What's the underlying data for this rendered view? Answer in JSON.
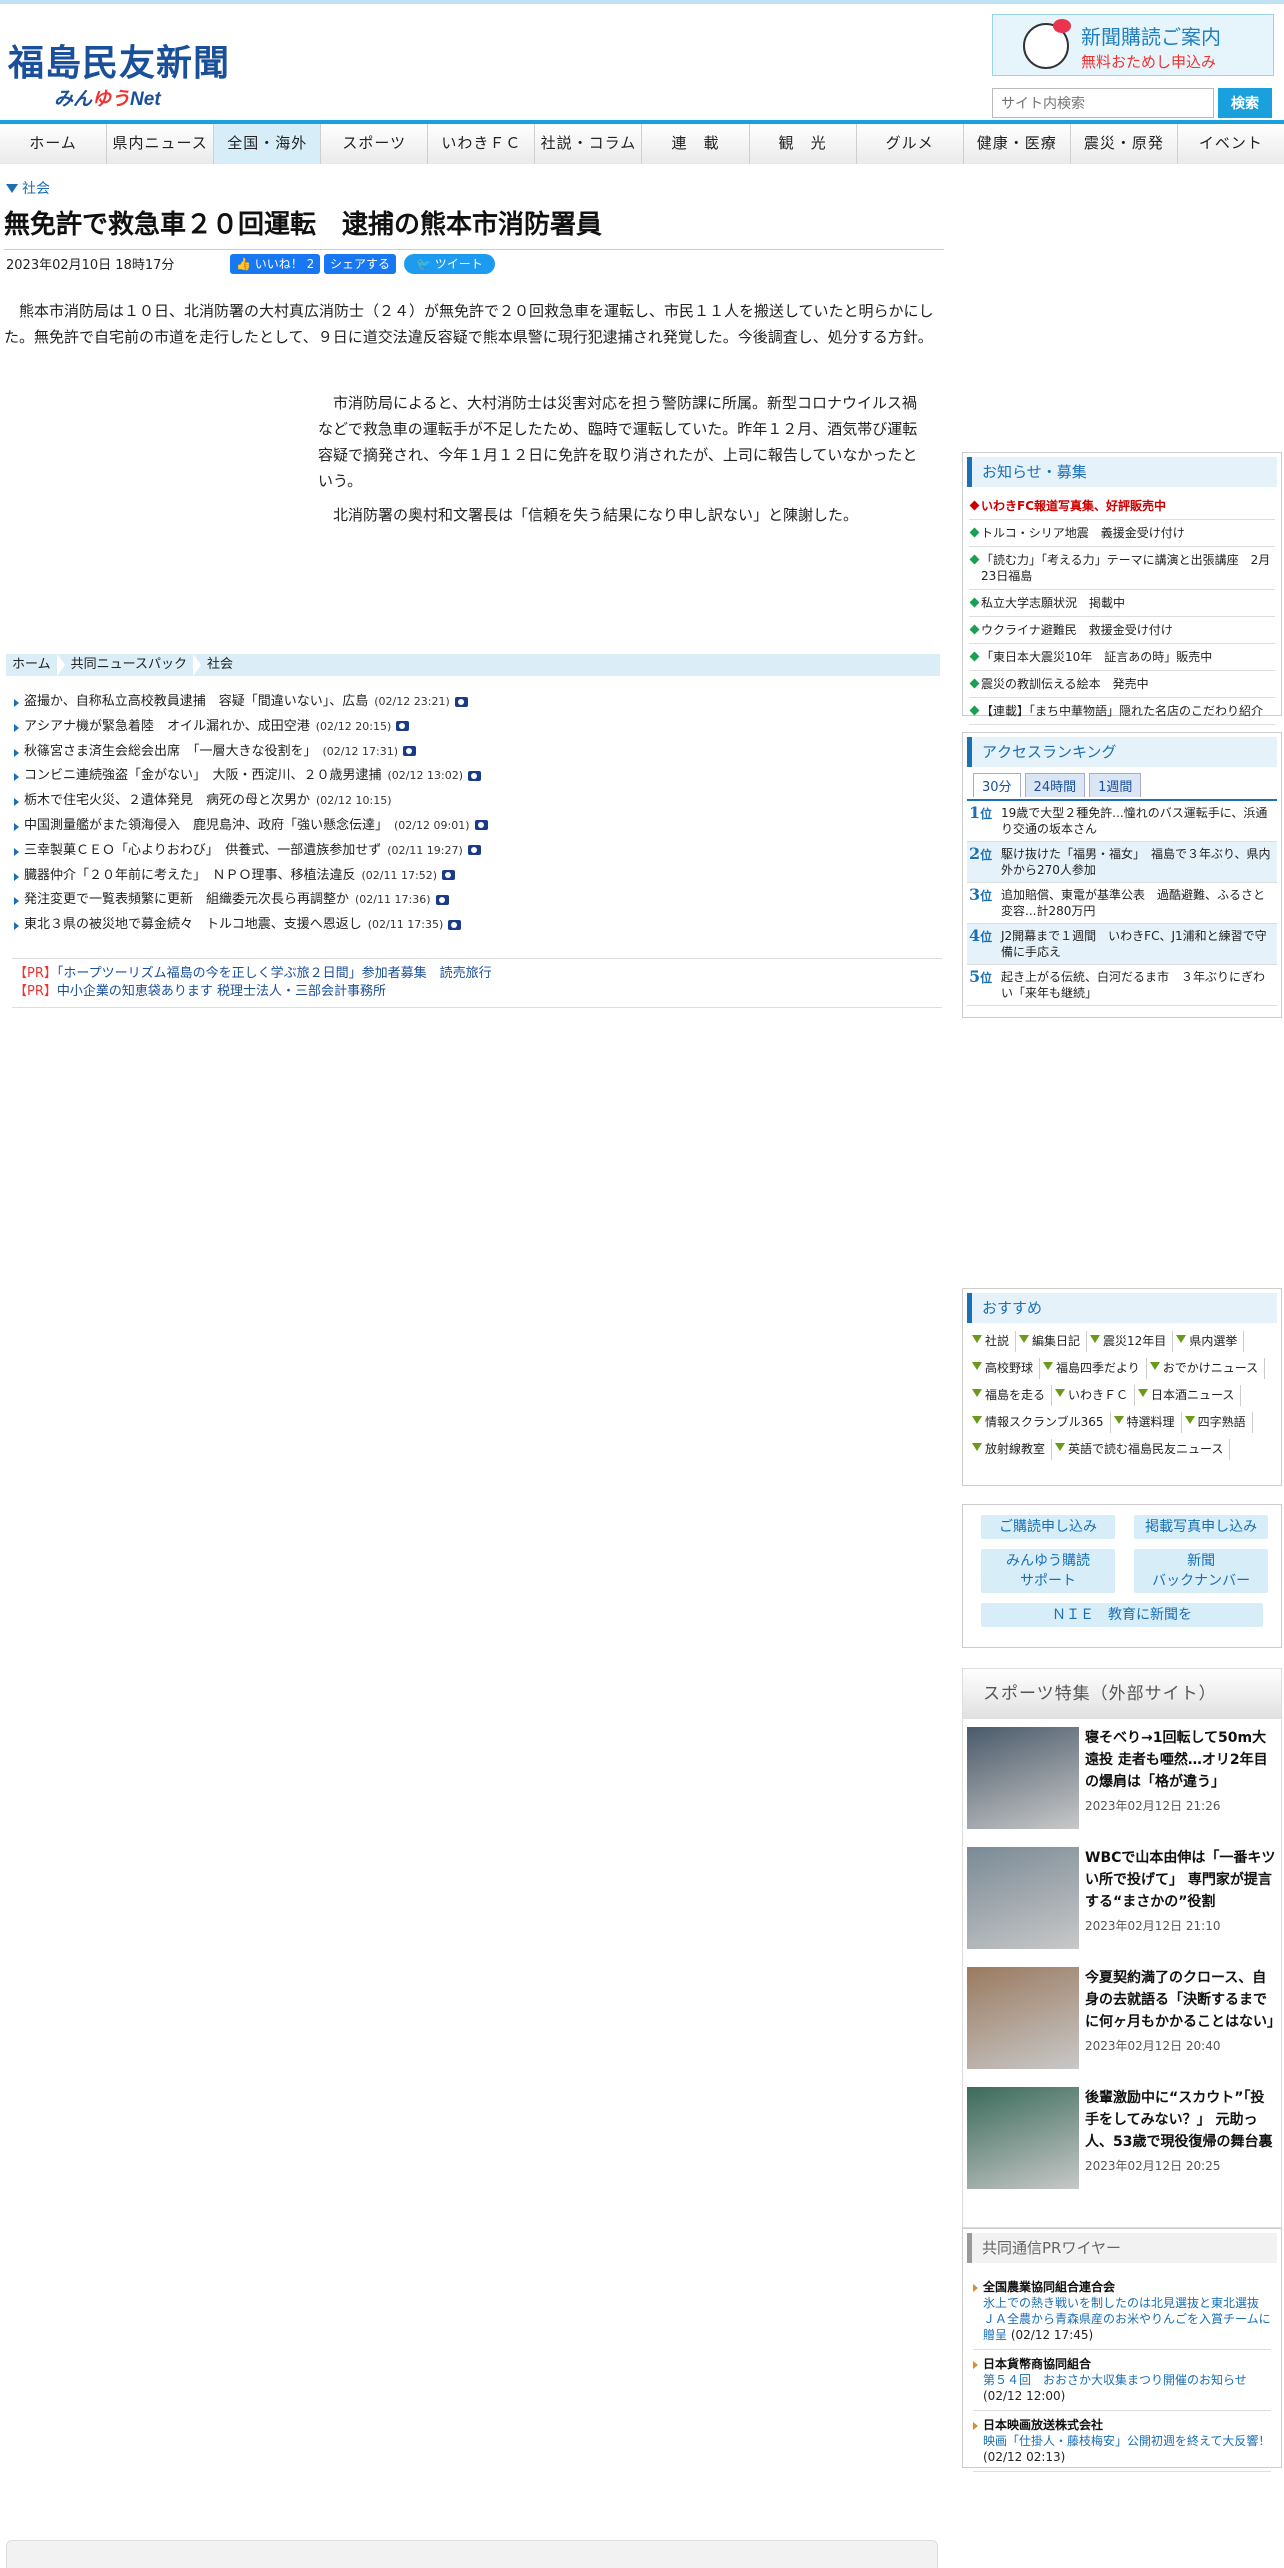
{
  "site": {
    "logo_main": "福島民友新聞",
    "logo_sub_a": "みん",
    "logo_sub_b": "ゆう",
    "logo_sub_c": "Net",
    "subscribe_title": "新聞購読ご案内",
    "subscribe_sub": "無料おためし申込み",
    "search_placeholder": "サイト内検索",
    "search_button": "検索"
  },
  "nav": [
    "ホーム",
    "県内ニュース",
    "全国・海外",
    "スポーツ",
    "いわきＦＣ",
    "社説・コラム",
    "連　載",
    "観　光",
    "グルメ",
    "健康・医療",
    "震災・原発",
    "イベント"
  ],
  "article": {
    "category": "社会",
    "title": "無免許で救急車２０回運転　逮捕の熊本市消防署員",
    "date": "2023年02月10日 18時17分",
    "fb_like": "いいね！ 2",
    "fb_share": "シェアする",
    "tweet": "ツイート",
    "lead": "熊本市消防局は１０日、北消防署の大村真広消防士（２４）が無免許で２０回救急車を運転し、市民１１人を搬送していたと明らかにした。無免許で自宅前の市道を走行したとして、９日に道交法違反容疑で熊本県警に現行犯逮捕され発覚した。今後調査し、処分する方針。",
    "p1": "市消防局によると、大村消防士は災害対応を担う警防課に所属。新型コロナウイルス禍などで救急車の運転手が不足したため、臨時で運転していた。昨年１２月、酒気帯び運転容疑で摘発され、今年１月１２日に免許を取り消されたが、上司に報告していなかったという。",
    "p2": "北消防署の奥村和文署長は「信頼を失う結果になり申し訳ない」と陳謝した。"
  },
  "breadcrumb": [
    "ホーム",
    "共同ニュースパック",
    "社会"
  ],
  "related_news": [
    {
      "title": "盗撮か、自称私立高校教員逮捕　容疑「間違いない」、広島",
      "time": "(02/12 23:21)",
      "cam": true
    },
    {
      "title": "アシアナ機が緊急着陸　オイル漏れか、成田空港",
      "time": "(02/12 20:15)",
      "cam": true
    },
    {
      "title": "秋篠宮さま済生会総会出席　「一層大きな役割を」",
      "time": "(02/12 17:31)",
      "cam": true
    },
    {
      "title": "コンビニ連続強盗「金がない」　大阪・西淀川、２０歳男逮捕",
      "time": "(02/12 13:02)",
      "cam": true
    },
    {
      "title": "栃木で住宅火災、２遺体発見　病死の母と次男か",
      "time": "(02/12 10:15)",
      "cam": false
    },
    {
      "title": "中国測量艦がまた領海侵入　鹿児島沖、政府「強い懸念伝達」",
      "time": "(02/12 09:01)",
      "cam": true
    },
    {
      "title": "三幸製菓ＣＥＯ「心よりおわび」　供養式、一部遺族参加せず",
      "time": "(02/11 19:27)",
      "cam": true
    },
    {
      "title": "臓器仲介「２０年前に考えた」　ＮＰＯ理事、移植法違反",
      "time": "(02/11 17:52)",
      "cam": true
    },
    {
      "title": "発注変更で一覧表頻繁に更新　組織委元次長ら再調整か",
      "time": "(02/11 17:36)",
      "cam": true
    },
    {
      "title": "東北３県の被災地で募金続々　トルコ地震、支援へ恩返し",
      "time": "(02/11 17:35)",
      "cam": true
    }
  ],
  "pr": [
    {
      "tag": "【PR】",
      "text": "「ホープツーリズム福島の今を正しく学ぶ旅２日間」参加者募集　読売旅行"
    },
    {
      "tag": "【PR】",
      "text": "中小企業の知恵袋あります 税理士法人・三部会計事務所"
    }
  ],
  "notices": {
    "title": "お知らせ・募集",
    "items": [
      {
        "text": "いわきFC報道写真集、好評販売中",
        "hot": true
      },
      {
        "text": "トルコ・シリア地震　義援金受け付け",
        "hot": false
      },
      {
        "text": "「読む力」「考える力」テーマに講演と出張講座　2月23日福島",
        "hot": false
      },
      {
        "text": "私立大学志願状況　掲載中",
        "hot": false
      },
      {
        "text": "ウクライナ避難民　救援金受け付け",
        "hot": false
      },
      {
        "text": "「東日本大震災10年　証言あの時」販売中",
        "hot": false
      },
      {
        "text": "震災の教訓伝える絵本　発売中",
        "hot": false
      },
      {
        "text": "【連載】「まち中華物語」隠れた名店のこだわり紹介",
        "hot": false
      }
    ]
  },
  "ranking": {
    "title": "アクセスランキング",
    "tabs": [
      "30分",
      "24時間",
      "1週間"
    ],
    "rank_suffix": "位",
    "items": [
      {
        "no": "1",
        "text": "19歳で大型２種免許...憧れのバス運転手に、浜通り交通の坂本さん"
      },
      {
        "no": "2",
        "text": "駆け抜けた「福男・福女」　福島で３年ぶり、県内外から270人参加"
      },
      {
        "no": "3",
        "text": "追加賠償、東電が基準公表　過酷避難、ふるさと変容...計280万円"
      },
      {
        "no": "4",
        "text": "J2開幕まで１週間　いわきFC、J1浦和と練習で守備に手応え"
      },
      {
        "no": "5",
        "text": "起き上がる伝統、白河だるま市　３年ぶりにぎわい「来年も継続」"
      }
    ]
  },
  "recommend": {
    "title": "おすすめ",
    "tags": [
      "社説",
      "編集日記",
      "震災12年目",
      "県内選挙",
      "高校野球",
      "福島四季だより",
      "おでかけニュース",
      "福島を走る",
      "いわきＦＣ",
      "日本酒ニュース",
      "情報スクランブル365",
      "特選料理",
      "四字熟語",
      "放射線教室",
      "英語で読む福島民友ニュース"
    ]
  },
  "buttons": {
    "subscribe": "ご購読申し込み",
    "photo": "掲載写真申し込み",
    "support_l1": "みんゆう購読",
    "support_l2": "サポート",
    "back_l1": "新聞",
    "back_l2": "バックナンバー",
    "nie": "ＮＩＥ　教育に新聞を"
  },
  "sports": {
    "title": "スポーツ特集（外部サイト）",
    "items": [
      {
        "title": "寝そべり→1回転して50m大遠投 走者も唖然…オリ2年目の爆肩は「格が違う」",
        "date": "2023年02月12日 21:26",
        "color": "#4a5a6a"
      },
      {
        "title": "WBCで山本由伸は「一番キツい所で投げて」 専門家が提言する“まさかの”役割",
        "date": "2023年02月12日 21:10",
        "color": "#7a8a96"
      },
      {
        "title": "今夏契約満了のクロース、自身の去就語る「決断するまでに何ヶ月もかかることはない」",
        "date": "2023年02月12日 20:40",
        "color": "#9a7a60"
      },
      {
        "title": "後輩激励中に“スカウト”「投手をしてみない？」 元助っ人、53歳で現役復帰の舞台裏",
        "date": "2023年02月12日 20:25",
        "color": "#3a6a5a"
      }
    ]
  },
  "kyodo_pr": {
    "title": "共同通信PRワイヤー",
    "items": [
      {
        "org": "全国農業協同組合連合会",
        "text": "氷上での熱き戦いを制したのは北見選抜と東北選抜 ＪＡ全農から青森県産のお米やりんごを入賞チームに贈呈",
        "time": "(02/12 17:45)"
      },
      {
        "org": "日本貨幣商協同組合",
        "text": "第５４回　おおさか大収集まつり開催のお知らせ",
        "time": "(02/12 12:00)"
      },
      {
        "org": "日本映画放送株式会社",
        "text": "映画「仕掛人・藤枝梅安」公開初週を終えて大反響！",
        "time": "(02/12 02:13)"
      }
    ]
  }
}
